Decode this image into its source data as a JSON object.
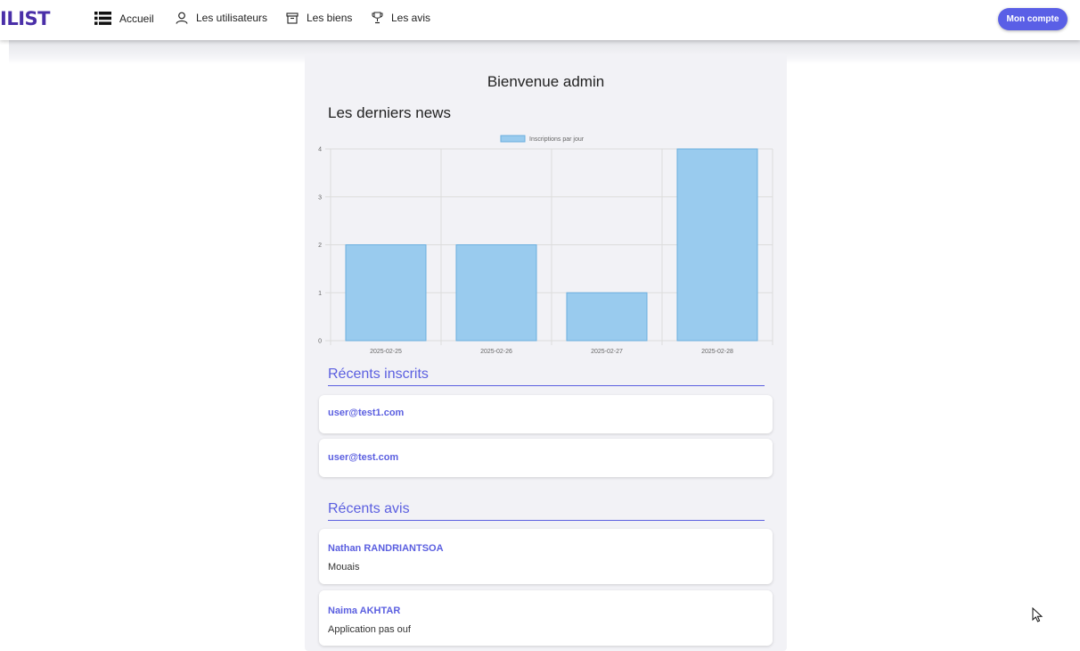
{
  "header": {
    "logo": "ILIST",
    "nav": [
      {
        "label": "Accueil",
        "icon": "list-icon"
      },
      {
        "label": "Les utilisateurs",
        "icon": "user-icon"
      },
      {
        "label": "Les biens",
        "icon": "archive-icon"
      },
      {
        "label": "Les avis",
        "icon": "trophy-icon"
      }
    ],
    "account_button": "Mon compte"
  },
  "main": {
    "welcome": "Bienvenue admin",
    "news_title": "Les derniers news",
    "recent_users_title": "Récents inscrits",
    "recent_users": [
      "user@test1.com",
      "user@test.com"
    ],
    "recent_reviews_title": "Récents avis",
    "recent_reviews": [
      {
        "author": "Nathan RANDRIANTSOA",
        "text": "Mouais"
      },
      {
        "author": "Naima AKHTAR",
        "text": "Application pas ouf"
      }
    ]
  },
  "colors": {
    "accent": "#5b5fe0",
    "button": "#5a5fe6",
    "bar_fill": "#99cbee",
    "bar_stroke": "#6aafdf"
  },
  "chart_data": {
    "type": "bar",
    "categories": [
      "2025-02-25",
      "2025-02-26",
      "2025-02-27",
      "2025-02-28"
    ],
    "series": [
      {
        "name": "Inscriptions par jour",
        "values": [
          2,
          2,
          1,
          4
        ]
      }
    ],
    "yticks": [
      "0",
      "1",
      "2",
      "3",
      "4"
    ],
    "ylim": [
      0,
      4
    ],
    "grid": true,
    "legend": "top"
  }
}
